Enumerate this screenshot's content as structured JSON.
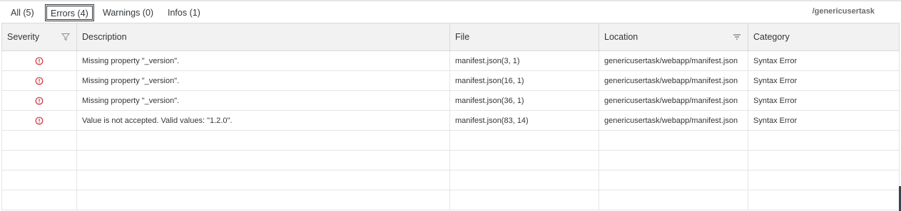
{
  "tabs": [
    {
      "label": "All (5)",
      "active": false
    },
    {
      "label": "Errors (4)",
      "active": true
    },
    {
      "label": "Warnings (0)",
      "active": false
    },
    {
      "label": "Infos (1)",
      "active": false
    }
  ],
  "project_name": "/genericusertask",
  "table": {
    "columns": [
      "Severity",
      "Description",
      "File",
      "Location",
      "Category"
    ],
    "rows": [
      {
        "severity_icon": "error-icon",
        "description": "Missing property \"_version\".",
        "file": "manifest.json(3, 1)",
        "location": "genericusertask/webapp/manifest.json",
        "category": "Syntax Error"
      },
      {
        "severity_icon": "error-icon",
        "description": "Missing property \"_version\".",
        "file": "manifest.json(16, 1)",
        "location": "genericusertask/webapp/manifest.json",
        "category": "Syntax Error"
      },
      {
        "severity_icon": "error-icon",
        "description": "Missing property \"_version\".",
        "file": "manifest.json(36, 1)",
        "location": "genericusertask/webapp/manifest.json",
        "category": "Syntax Error"
      },
      {
        "severity_icon": "error-icon",
        "description": "Value is not accepted. Valid values: \"1.2.0\".",
        "file": "manifest.json(83, 14)",
        "location": "genericusertask/webapp/manifest.json",
        "category": "Syntax Error"
      }
    ]
  },
  "colors": {
    "error": "#d2353b",
    "link": "#2f6fae",
    "header_bg": "#f2f2f2"
  }
}
